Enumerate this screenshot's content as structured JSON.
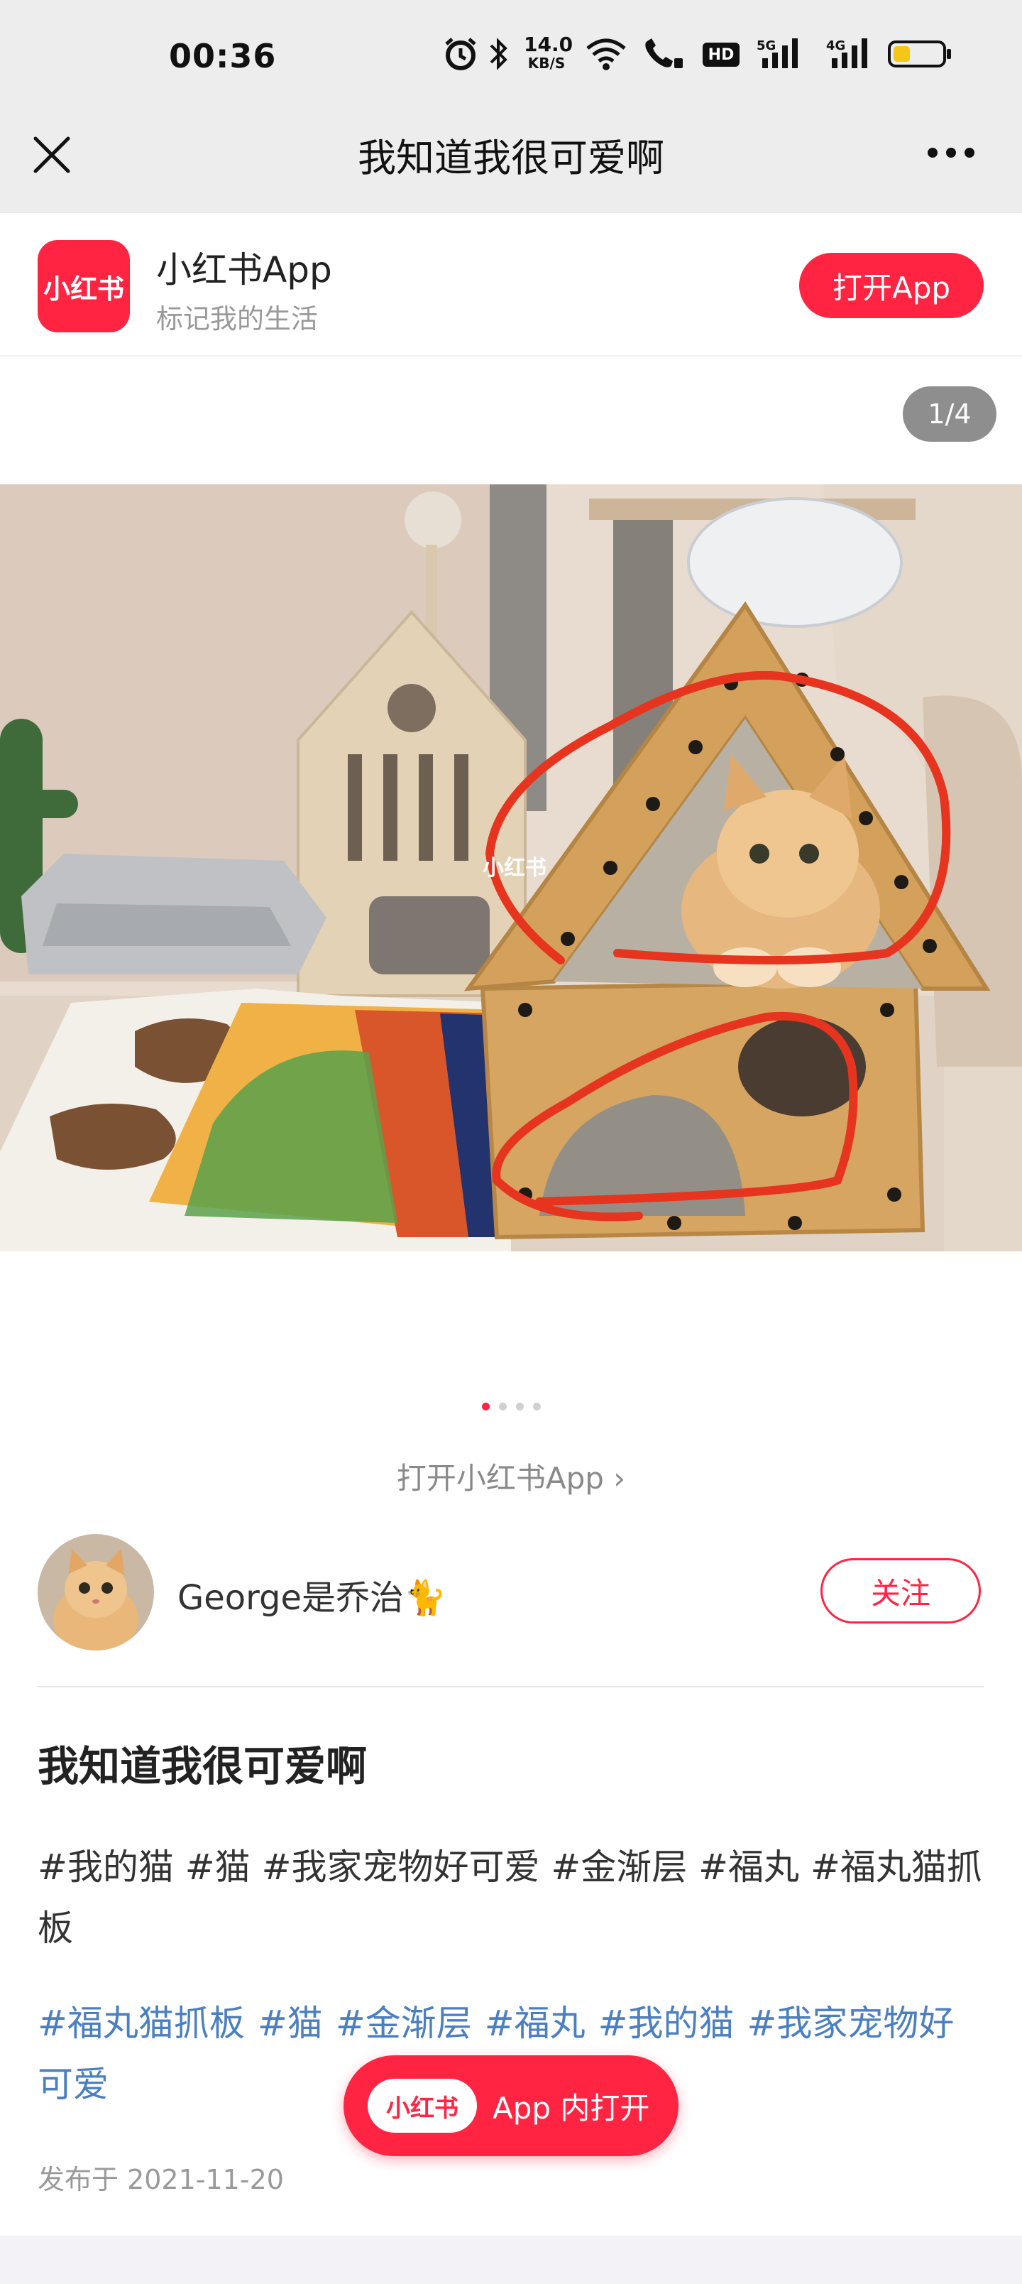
{
  "status_bar": {
    "time": "00:36",
    "net_speed_value": "14.0",
    "net_speed_unit": "KB/S",
    "hd_label": "HD",
    "signal1_label": "5G",
    "signal2_label": "4G",
    "battery_level": 0.35,
    "battery_color": "#f5c518"
  },
  "nav": {
    "title": "我知道我很可爱啊"
  },
  "banner": {
    "logo_text": "小红书",
    "app_name": "小红书App",
    "slogan": "标记我的生活",
    "open_button": "打开App"
  },
  "gallery": {
    "counter": "1/4",
    "watermark": "小红书",
    "dots_total": 4,
    "dots_active": 1,
    "accent_color": "#ff2442"
  },
  "open_link": "打开小红书App ›",
  "author": {
    "name": "George是乔治🐈",
    "follow_label": "关注"
  },
  "post": {
    "title": "我知道我很可爱啊",
    "body": "#我的猫 #猫 #我家宠物好可爱 #金渐层 #福丸 #福丸猫抓板",
    "tags": [
      "#福丸猫抓板",
      "#猫",
      "#金渐层",
      "#福丸",
      "#我的猫",
      "#我家宠物好可爱"
    ],
    "date": "发布于 2021-11-20"
  },
  "floating": {
    "logo_text": "小红书",
    "label": "App 内打开"
  }
}
